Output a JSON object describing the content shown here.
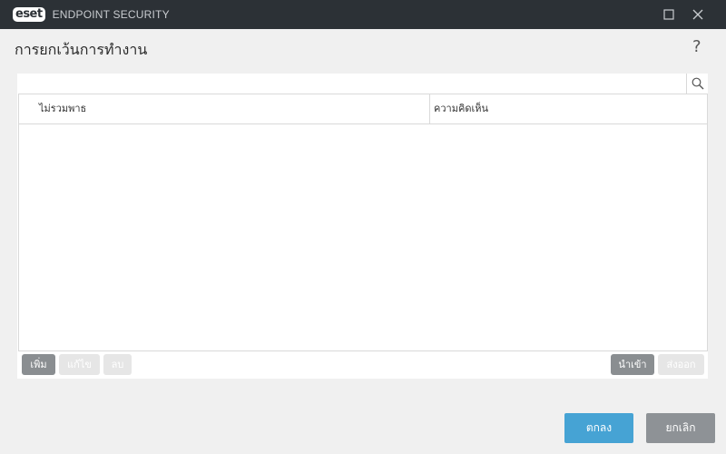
{
  "window": {
    "logo_text": "eset",
    "product_name": "ENDPOINT SECURITY",
    "maximize_icon": "square-icon",
    "close_icon": "x-icon"
  },
  "page": {
    "title": "การยกเว้นการทำงาน",
    "help_label": "?"
  },
  "search": {
    "value": "",
    "placeholder": "",
    "icon": "magnifier-icon"
  },
  "table": {
    "columns": [
      "ไม่รวมพาธ",
      "ความคิดเห็น"
    ],
    "rows": []
  },
  "toolbar": {
    "add_label": "เพิ่ม",
    "edit_label": "แก้ไข",
    "delete_label": "ลบ",
    "import_label": "นำเข้า",
    "export_label": "ส่งออก"
  },
  "footer": {
    "ok_label": "ตกลง",
    "cancel_label": "ยกเลิก"
  },
  "colors": {
    "titlebar_bg": "#2c3136",
    "ok_button": "#46a3d4",
    "cancel_button": "#8e9296",
    "toolbar_active": "#8a8e91",
    "toolbar_disabled": "#e6e6e6"
  }
}
